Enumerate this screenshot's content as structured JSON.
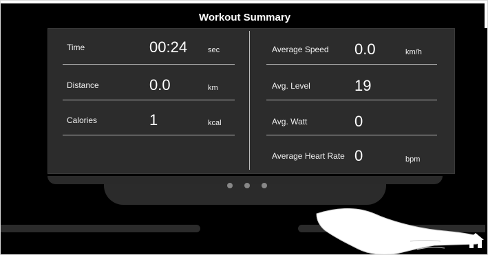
{
  "title": "Workout Summary",
  "left_metrics": [
    {
      "label": "Time",
      "value": "00:24",
      "unit": "sec"
    },
    {
      "label": "Distance",
      "value": "0.0",
      "unit": "km"
    },
    {
      "label": "Calories",
      "value": "1",
      "unit": "kcal"
    }
  ],
  "right_metrics": [
    {
      "label": "Average Speed",
      "value": "0.0",
      "unit": "km/h"
    },
    {
      "label": "Avg. Level",
      "value": "19",
      "unit": ""
    },
    {
      "label": "Avg. Watt",
      "value": "0",
      "unit": ""
    },
    {
      "label": "Average Heart Rate",
      "value": "0",
      "unit": "bpm"
    }
  ],
  "pager": {
    "count": 3,
    "active_index": 0
  },
  "icons": {
    "home": "home-icon"
  },
  "colors": {
    "panel": "#2c2c2c",
    "background": "#000000",
    "text": "#ffffff"
  }
}
